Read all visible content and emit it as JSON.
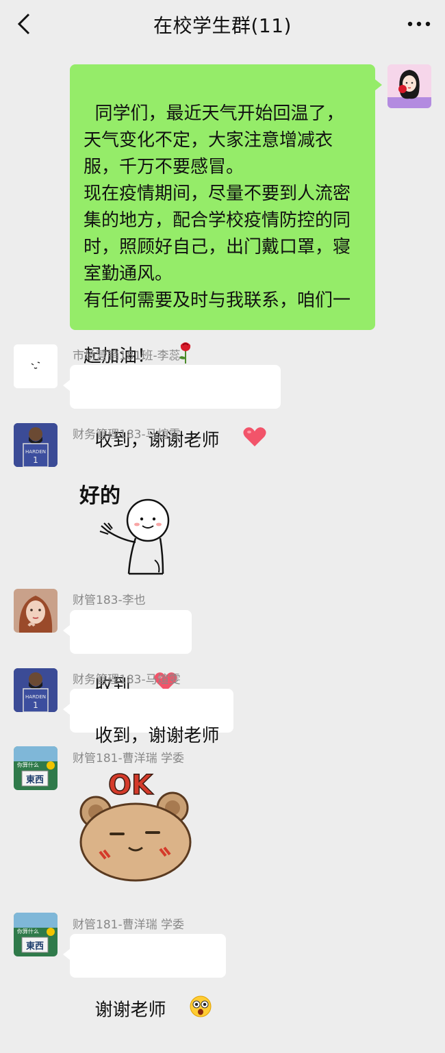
{
  "header": {
    "title": "在校学生群(11)",
    "back_icon": "chevron-left-icon",
    "more_icon": "more-icon"
  },
  "messages": [
    {
      "side": "right",
      "text": "同学们，最近天气开始回温了，天气变化不定，大家注意增减衣服，千万不要感冒。\n现在疫情期间，尽量不要到人流密集的地方，配合学校疫情防控的同时，照顾好自己，出门戴口罩，寝室勤通风。\n有任何需要及时与我联系，咱们一起加油！",
      "emoji": "rose-emoji"
    },
    {
      "side": "left",
      "sender": "市场营销181班-李蕊",
      "text": "收到，谢谢老师",
      "emoji": "heart-emoji"
    },
    {
      "side": "left",
      "sender": "财务管理183-马煊雯",
      "sticker": "好的",
      "sticker_icon": "waving-stickman-sticker"
    },
    {
      "side": "left",
      "sender": "财管183-李也",
      "text": "收到",
      "emoji": "heart-emoji"
    },
    {
      "side": "left",
      "sender": "财务管理183-马煊雯",
      "text": "收到，谢谢老师"
    },
    {
      "side": "left",
      "sender": "财管181-曹洋瑞 学委",
      "sticker": "OK",
      "sticker_icon": "bear-ok-sticker"
    },
    {
      "side": "left",
      "sender": "财管181-曹洋瑞 学委",
      "text": "谢谢老师",
      "emoji": "surprised-face-emoji"
    }
  ],
  "avatar_text": {
    "cao_line1": "你算什么",
    "cao_line2": "東西",
    "ma_jersey": "HARDEN"
  },
  "colors": {
    "background": "#ededed",
    "self_bubble": "#95ec69",
    "other_bubble": "#ffffff",
    "name_text": "#888888"
  }
}
